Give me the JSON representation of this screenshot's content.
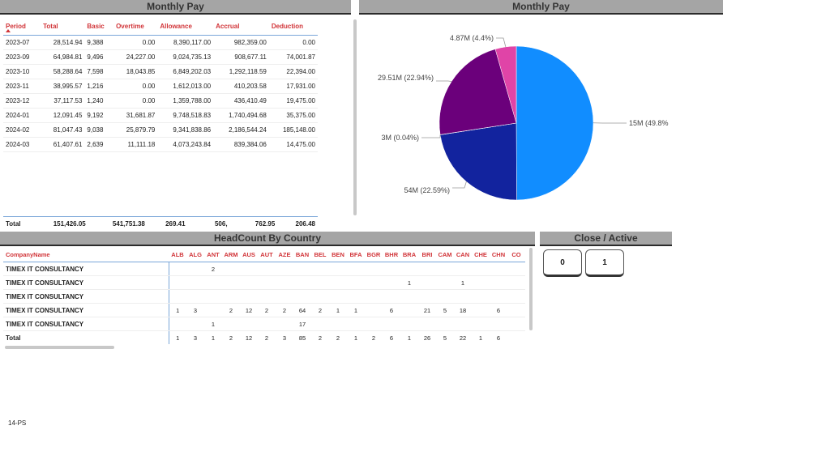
{
  "left_panel": {
    "title": "Monthly Pay",
    "columns": [
      "Period",
      "Total",
      "Basic",
      "Overtime",
      "Allowance",
      "Accrual",
      "Deduction"
    ],
    "rows": [
      [
        "2023-07",
        "28,514.94",
        "9,388",
        "0.00",
        "8,390,117.00",
        "982,359.00",
        "0.00"
      ],
      [
        "2023-09",
        "64,984.81",
        "9,496",
        "24,227.00",
        "9,024,735.13",
        "908,677.11",
        "74,001.87"
      ],
      [
        "2023-10",
        "58,288.64",
        "7,598",
        "18,043.85",
        "6,849,202.03",
        "1,292,118.59",
        "22,394.00"
      ],
      [
        "2023-11",
        "38,995.57",
        "1,216",
        "0.00",
        "1,612,013.00",
        "410,203.58",
        "17,931.00"
      ],
      [
        "2023-12",
        "37,117.53",
        "1,240",
        "0.00",
        "1,359,788.00",
        "436,410.49",
        "19,475.00"
      ],
      [
        "2024-01",
        "12,091.45",
        "9,192",
        "31,681.87",
        "9,748,518.83",
        "1,740,494.68",
        "35,375.00"
      ],
      [
        "2024-02",
        "81,047.43",
        "9,038",
        "25,879.79",
        "9,341,838.86",
        "2,186,544.24",
        "185,148.00"
      ],
      [
        "2024-03",
        "61,407.61",
        "2,639",
        "11,111.18",
        "4,073,243.84",
        "839,384.06",
        "14,475.00"
      ]
    ],
    "total_row": [
      "Total",
      "151,426.05",
      "541,751.38",
      "269.41",
      "506,",
      "762.95",
      "206.48"
    ]
  },
  "right_panel": {
    "title": "Monthly Pay",
    "chart_data": {
      "type": "pie",
      "slices": [
        {
          "label": "15M (49.8%",
          "value": 49.8,
          "color": "#118dff"
        },
        {
          "label": "54M (22.59%)",
          "value": 22.59,
          "color": "#12239e"
        },
        {
          "label": "3M (0.04%)",
          "value": 0.04,
          "color": "#e66c37"
        },
        {
          "label": "29.51M (22.94%)",
          "value": 22.94,
          "color": "#6b007b"
        },
        {
          "label": "4.87M (4.4%)",
          "value": 4.4,
          "color": "#e044a7"
        }
      ]
    }
  },
  "headcount": {
    "title": "HeadCount By Country",
    "company_header": "CompanyName",
    "countries": [
      "ALB",
      "ALG",
      "ANT",
      "ARM",
      "AUS",
      "AUT",
      "AZE",
      "BAN",
      "BEL",
      "BEN",
      "BFA",
      "BGR",
      "BHR",
      "BRA",
      "BRI",
      "CAM",
      "CAN",
      "CHE",
      "CHN",
      "CO"
    ],
    "rows": [
      {
        "name": "TIMEX IT CONSULTANCY",
        "values": [
          "",
          "",
          "2",
          "",
          "",
          "",
          "",
          "",
          "",
          "",
          "",
          "",
          "",
          "",
          "",
          "",
          "",
          "",
          "",
          ""
        ]
      },
      {
        "name": "TIMEX IT CONSULTANCY",
        "values": [
          "",
          "",
          "",
          "",
          "",
          "",
          "",
          "",
          "",
          "",
          "",
          "",
          "",
          "1",
          "",
          "",
          "1",
          "",
          "",
          ""
        ]
      },
      {
        "name": "TIMEX IT CONSULTANCY",
        "values": [
          "",
          "",
          "",
          "",
          "",
          "",
          "",
          "",
          "",
          "",
          "",
          "",
          "",
          "",
          "",
          "",
          "",
          "",
          "",
          ""
        ]
      },
      {
        "name": "TIMEX IT CONSULTANCY",
        "values": [
          "1",
          "3",
          "",
          "2",
          "12",
          "2",
          "2",
          "64",
          "2",
          "1",
          "1",
          "",
          "6",
          "",
          "21",
          "5",
          "18",
          "",
          "6",
          ""
        ]
      },
      {
        "name": "TIMEX IT CONSULTANCY",
        "values": [
          "",
          "",
          "1",
          "",
          "",
          "",
          "",
          "17",
          "",
          "",
          "",
          "",
          "",
          "",
          "",
          "",
          "",
          "",
          "",
          ""
        ]
      }
    ],
    "total_label": "Total",
    "totals": [
      "1",
      "3",
      "1",
      "2",
      "12",
      "2",
      "3",
      "85",
      "2",
      "2",
      "1",
      "2",
      "6",
      "1",
      "26",
      "5",
      "22",
      "1",
      "6",
      ""
    ]
  },
  "close_active": {
    "title": "Close / Active",
    "buttons": [
      "0",
      "1"
    ]
  },
  "footer": "14-PS"
}
